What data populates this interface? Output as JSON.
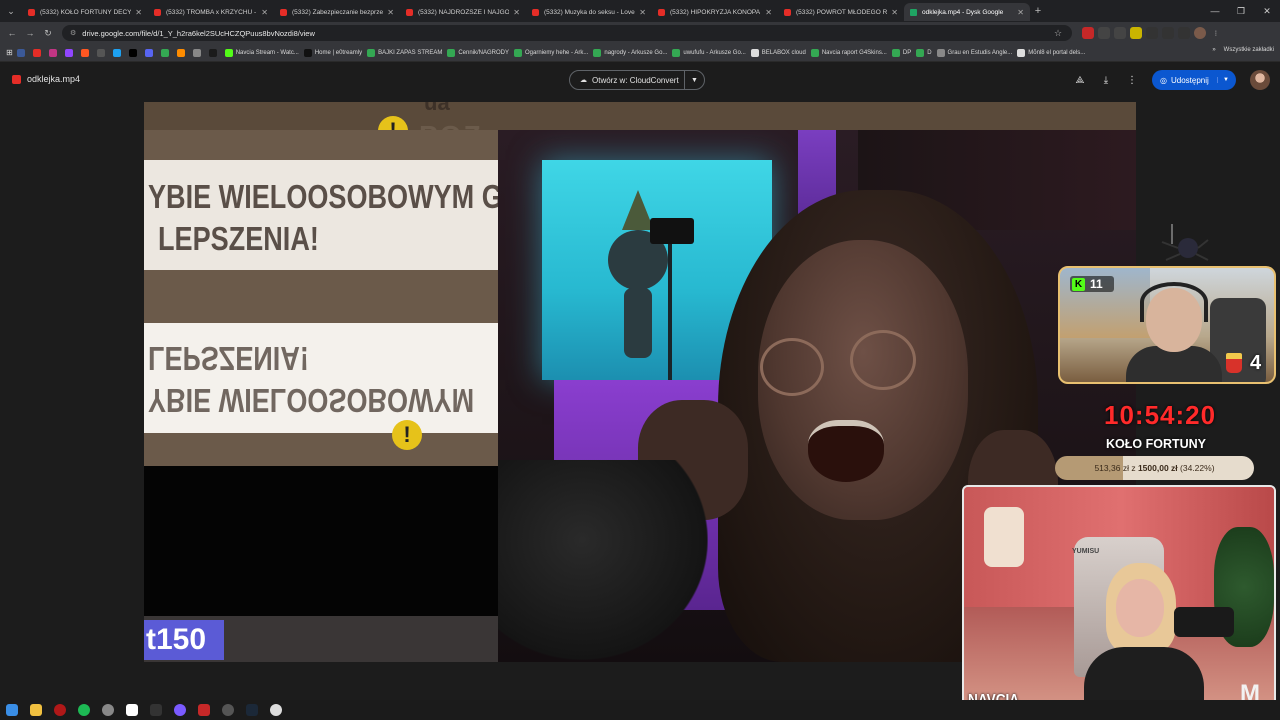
{
  "browser": {
    "tabs": [
      {
        "title": "(5332) KOŁO FORTUNY DECYDUJE",
        "active": false
      },
      {
        "title": "(5332) TROMBA x KRZYCHU - ŁEZ",
        "active": false
      },
      {
        "title": "(5332) Zabezpieczanie bezprzewo",
        "active": false
      },
      {
        "title": "(5332) NAJDROŻSZE I NAJGORSZE",
        "active": false
      },
      {
        "title": "(5332) Muzyka do seksu - Love m",
        "active": false
      },
      {
        "title": "(5332) HIPOKRYZJA KONOPA I RE",
        "active": false
      },
      {
        "title": "(5332) POWRÓT MŁODEGO RAN",
        "active": false
      },
      {
        "title": "odklejka.mp4 - Dysk Google",
        "active": true
      }
    ],
    "url": "drive.google.com/file/d/1_Y_h2ra6kel2SUcHCZQPuus8bvNozdi8/view",
    "bookmarks": [
      {
        "label": "",
        "color": "#3b5998"
      },
      {
        "label": "",
        "color": "#e52d27"
      },
      {
        "label": "",
        "color": "#c13584"
      },
      {
        "label": "",
        "color": "#9146ff"
      },
      {
        "label": "",
        "color": "#ff5722"
      },
      {
        "label": "",
        "color": "#555555"
      },
      {
        "label": "",
        "color": "#1da1f2"
      },
      {
        "label": "",
        "color": "#000000"
      },
      {
        "label": "",
        "color": "#5865f2"
      },
      {
        "label": "",
        "color": "#34a853"
      },
      {
        "label": "",
        "color": "#ff8c00"
      },
      {
        "label": "",
        "color": "#888888"
      },
      {
        "label": "",
        "color": "#1b1b1b"
      },
      {
        "label": "Navcia Stream - Watc...",
        "color": "#53fc18"
      },
      {
        "label": "Home | e0treamly",
        "color": "#111111"
      },
      {
        "label": "BAJKI ZAPAS STREAM",
        "color": "#34a853"
      },
      {
        "label": "Cennik/NAGRODY",
        "color": "#34a853"
      },
      {
        "label": "Ogarniemy hehe - Ark...",
        "color": "#34a853"
      },
      {
        "label": "nagrody - Arkusze Go...",
        "color": "#34a853"
      },
      {
        "label": "uwufufu - Arkusze Go...",
        "color": "#34a853"
      },
      {
        "label": "BELABOX cloud",
        "color": "#dddddd"
      },
      {
        "label": "Navcia raport G4Skins...",
        "color": "#34a853"
      },
      {
        "label": "DP",
        "color": "#34a853"
      },
      {
        "label": "D",
        "color": "#34a853"
      },
      {
        "label": "Grau en Estudis Angle...",
        "color": "#888888"
      },
      {
        "label": "Mõnl8 el portal dels...",
        "color": "#dddddd"
      }
    ],
    "bookmarks_more": "»",
    "all_bookmarks": "Wszystkie zakładki"
  },
  "drive": {
    "file_name": "odklejka.mp4",
    "open_with": "Otwórz w: CloudConvert",
    "share": "Udostępnij"
  },
  "video": {
    "banner_line1": "YBIE WIELOOSOBOWYM G",
    "banner_line2": "LEPSZENIA!",
    "mirror_line1": "LEPSZENIA!",
    "mirror_line2": "YBIE WIELOOSOBOWYM",
    "top_text": "POZ",
    "warn_symbol": "!",
    "tag": "t150"
  },
  "overlay": {
    "kick_count": "11",
    "fries_count": "4",
    "timer": "10:54:20",
    "wheel_title": "KOŁO FORTUNY",
    "goal_current": "513,36 zł",
    "goal_sep": "z",
    "goal_target": "1500,00 zł",
    "goal_percent": "(34.22%)",
    "goal_fraction": 0.3422,
    "streamer_name": "NAVCIA",
    "chair_brand": "YUMISU",
    "logo": "M"
  },
  "colors": {
    "timer_red": "#ff2a2a",
    "kick_green": "#53fc18",
    "share_blue": "#0b57d0",
    "tag_purple": "#5b5bd6"
  }
}
